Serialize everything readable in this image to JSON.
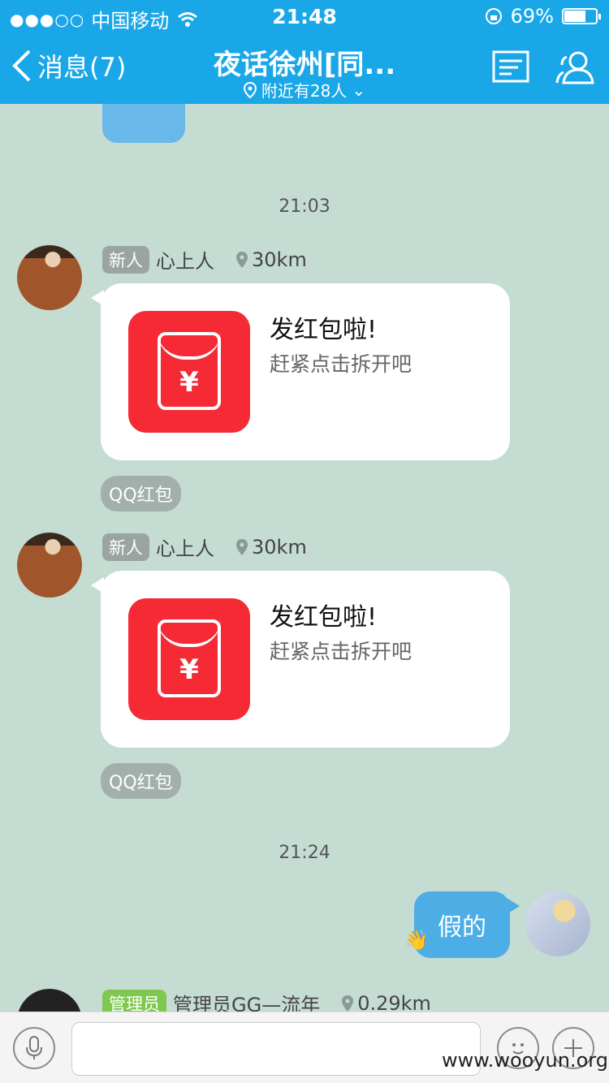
{
  "status": {
    "carrier": "中国移动",
    "time": "21:48",
    "battery": "69%"
  },
  "nav": {
    "back": "消息(7)",
    "title": "夜话徐州[同...",
    "subtitle": "附近有28人"
  },
  "chat": {
    "ts1": "21:03",
    "ts2": "21:24",
    "msg1": {
      "tag": "新人",
      "sender": "心上人",
      "distance": "30km",
      "rp_title": "发红包啦!",
      "rp_sub": "赶紧点击拆开吧",
      "source": "QQ红包"
    },
    "msg2": {
      "tag": "新人",
      "sender": "心上人",
      "distance": "30km",
      "rp_title": "发红包啦!",
      "rp_sub": "赶紧点击拆开吧",
      "source": "QQ红包"
    },
    "mine": {
      "text": "假的"
    },
    "msg3": {
      "tag": "管理员",
      "sender": "管理员GG—流年",
      "distance": "0.29km"
    }
  },
  "watermark": "www.wooyun.org",
  "colors": {
    "header": "#1aa7e8",
    "background": "#c5dcd3",
    "redpacket": "#f52a35"
  }
}
